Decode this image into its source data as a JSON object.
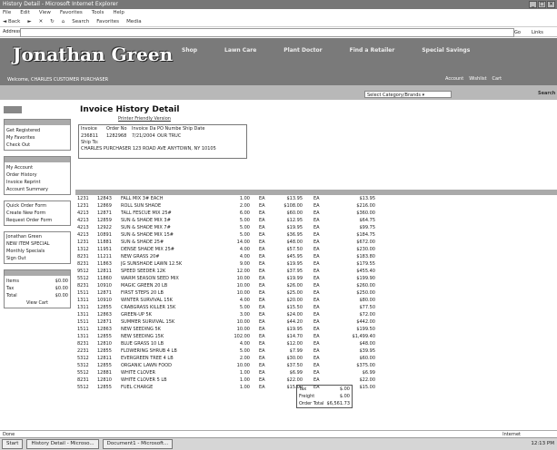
{
  "window": {
    "title": "History Detail - Microsoft Internet Explorer"
  },
  "menu": [
    "File",
    "Edit",
    "View",
    "Favorites",
    "Tools",
    "Help"
  ],
  "toolbar": [
    "Back",
    "Search",
    "Favorites",
    "Media"
  ],
  "address": {
    "label": "Address",
    "go": "Go",
    "links": "Links"
  },
  "site": {
    "logo": "Jonathan Green",
    "nav": [
      "Shop",
      "Lawn Care",
      "Plant Doctor",
      "Find a Retailer",
      "Special Savings"
    ],
    "welcome": "Welcome, CHARLES CUSTOMER PURCHASER",
    "account": [
      "Account",
      "Wishlist",
      "Cart"
    ],
    "category_select": "Select Category/Brands",
    "search_button": "Search"
  },
  "sidebar": {
    "group1": [
      "Get Registered",
      "My Favorites",
      "Check Out"
    ],
    "group2": [
      "My Account",
      "Order History",
      "Invoice Reprint",
      "Account Summary"
    ],
    "group3": [
      "Quick Order Form",
      "Create New Form",
      "Request Order Form"
    ],
    "group4": [
      "Jonathan Green",
      "NEW ITEM SPECIAL",
      "Monthly Specials",
      "Sign Out"
    ],
    "cart": [
      {
        "label": "Items",
        "value": "$0.00"
      },
      {
        "label": "Tax",
        "value": "$0.00"
      },
      {
        "label": "Total",
        "value": "$0.00"
      }
    ],
    "cart_link": "View Cart"
  },
  "page": {
    "title": "Invoice History Detail",
    "printer_link": "Printer Friendly Version",
    "info_headers": [
      "Invoice",
      "Order No",
      "Invoice Date",
      "PO Number",
      "Ship Date"
    ],
    "info_values": [
      "236811",
      "1282968",
      "7/21/2004",
      "OUR TRUCK",
      ""
    ],
    "ship_via_label": "Ship To:",
    "ship_to": "CHARLES PURCHASER 123 ROAD AVE ANYTOWN, NY 10105"
  },
  "table": {
    "rows": [
      [
        "1231",
        "12843",
        "FALL MIX 3# EACH",
        "1.00",
        "EA",
        "$13.95",
        "EA",
        "$13.95"
      ],
      [
        "1231",
        "12869",
        "ROLL SUN SHADE",
        "2.00",
        "EA",
        "$108.00",
        "EA",
        "$216.00"
      ],
      [
        "4213",
        "12871",
        "TALL FESCUE MIX 25#",
        "6.00",
        "EA",
        "$60.00",
        "EA",
        "$360.00"
      ],
      [
        "4213",
        "12859",
        "SUN & SHADE MIX 3#",
        "5.00",
        "EA",
        "$12.95",
        "EA",
        "$64.75"
      ],
      [
        "4213",
        "12922",
        "SUN & SHADE MIX 7#",
        "5.00",
        "EA",
        "$19.95",
        "EA",
        "$99.75"
      ],
      [
        "4213",
        "10891",
        "SUN & SHADE MIX 15#",
        "5.00",
        "EA",
        "$36.95",
        "EA",
        "$184.75"
      ],
      [
        "1231",
        "11881",
        "SUN & SHADE 25#",
        "14.00",
        "EA",
        "$48.00",
        "EA",
        "$672.00"
      ],
      [
        "1312",
        "11951",
        "DENSE SHADE MIX 25#",
        "4.00",
        "EA",
        "$57.50",
        "EA",
        "$230.00"
      ],
      [
        "8231",
        "11211",
        "NEW GRASS 20#",
        "4.00",
        "EA",
        "$45.95",
        "EA",
        "$183.80"
      ],
      [
        "8231",
        "11863",
        "JG SUNSHADE LAWN 12.5K",
        "9.00",
        "EA",
        "$19.95",
        "EA",
        "$179.55"
      ],
      [
        "9512",
        "12811",
        "SPEED SEEDER 12K",
        "12.00",
        "EA",
        "$37.95",
        "EA",
        "$455.40"
      ],
      [
        "5512",
        "11860",
        "WARM SEASON SEED MIX",
        "10.00",
        "EA",
        "$19.99",
        "EA",
        "$199.90"
      ],
      [
        "8231",
        "10910",
        "MAGIC GREEN 20 LB",
        "10.00",
        "EA",
        "$26.00",
        "EA",
        "$260.00"
      ],
      [
        "1511",
        "12871",
        "FIRST STEPS 20 LB",
        "10.00",
        "EA",
        "$25.00",
        "EA",
        "$250.00"
      ],
      [
        "1311",
        "10910",
        "WINTER SURVIVAL 15K",
        "4.00",
        "EA",
        "$20.00",
        "EA",
        "$80.00"
      ],
      [
        "1311",
        "12855",
        "CRABGRASS KILLER 15K",
        "5.00",
        "EA",
        "$15.50",
        "EA",
        "$77.50"
      ],
      [
        "1311",
        "12863",
        "GREEN-UP 5K",
        "3.00",
        "EA",
        "$24.00",
        "EA",
        "$72.00"
      ],
      [
        "1511",
        "12871",
        "SUMMER SURVIVAL 15K",
        "10.00",
        "EA",
        "$44.20",
        "EA",
        "$442.00"
      ],
      [
        "1511",
        "12863",
        "NEW SEEDING 5K",
        "10.00",
        "EA",
        "$19.95",
        "EA",
        "$199.50"
      ],
      [
        "1311",
        "12855",
        "NEW SEEDING 15K",
        "102.00",
        "EA",
        "$14.70",
        "EA",
        "$1,499.40"
      ],
      [
        "8231",
        "12810",
        "BLUE GRASS 10 LB",
        "4.00",
        "EA",
        "$12.00",
        "EA",
        "$48.00"
      ],
      [
        "2231",
        "12855",
        "FLOWERING SHRUB 4 LB",
        "5.00",
        "EA",
        "$7.99",
        "EA",
        "$39.95"
      ],
      [
        "5312",
        "12811",
        "EVERGREEN TREE 4 LB",
        "2.00",
        "EA",
        "$30.00",
        "EA",
        "$60.00"
      ],
      [
        "5312",
        "12855",
        "ORGANIC LAWN FOOD",
        "10.00",
        "EA",
        "$37.50",
        "EA",
        "$375.00"
      ],
      [
        "5512",
        "12881",
        "WHITE CLOVER",
        "1.00",
        "EA",
        "$6.99",
        "EA",
        "$6.99"
      ],
      [
        "8231",
        "12810",
        "WHITE CLOVER 5 LB",
        "1.00",
        "EA",
        "$22.00",
        "EA",
        "$22.00"
      ],
      [
        "5512",
        "12855",
        "FUEL CHARGE",
        "1.00",
        "EA",
        "$15.00",
        "EA",
        "$15.00"
      ]
    ]
  },
  "totals": [
    {
      "label": "Tax",
      "value": "$.00"
    },
    {
      "label": "Freight",
      "value": "$.00"
    },
    {
      "label": "Order Total",
      "value": "$6,561.73"
    }
  ],
  "status": {
    "left": "Done",
    "zone": "Internet"
  },
  "taskbar": {
    "start": "Start",
    "items": [
      "History Detail - Microso...",
      "Document1 - Microsoft..."
    ],
    "clock": "12:13 PM"
  }
}
